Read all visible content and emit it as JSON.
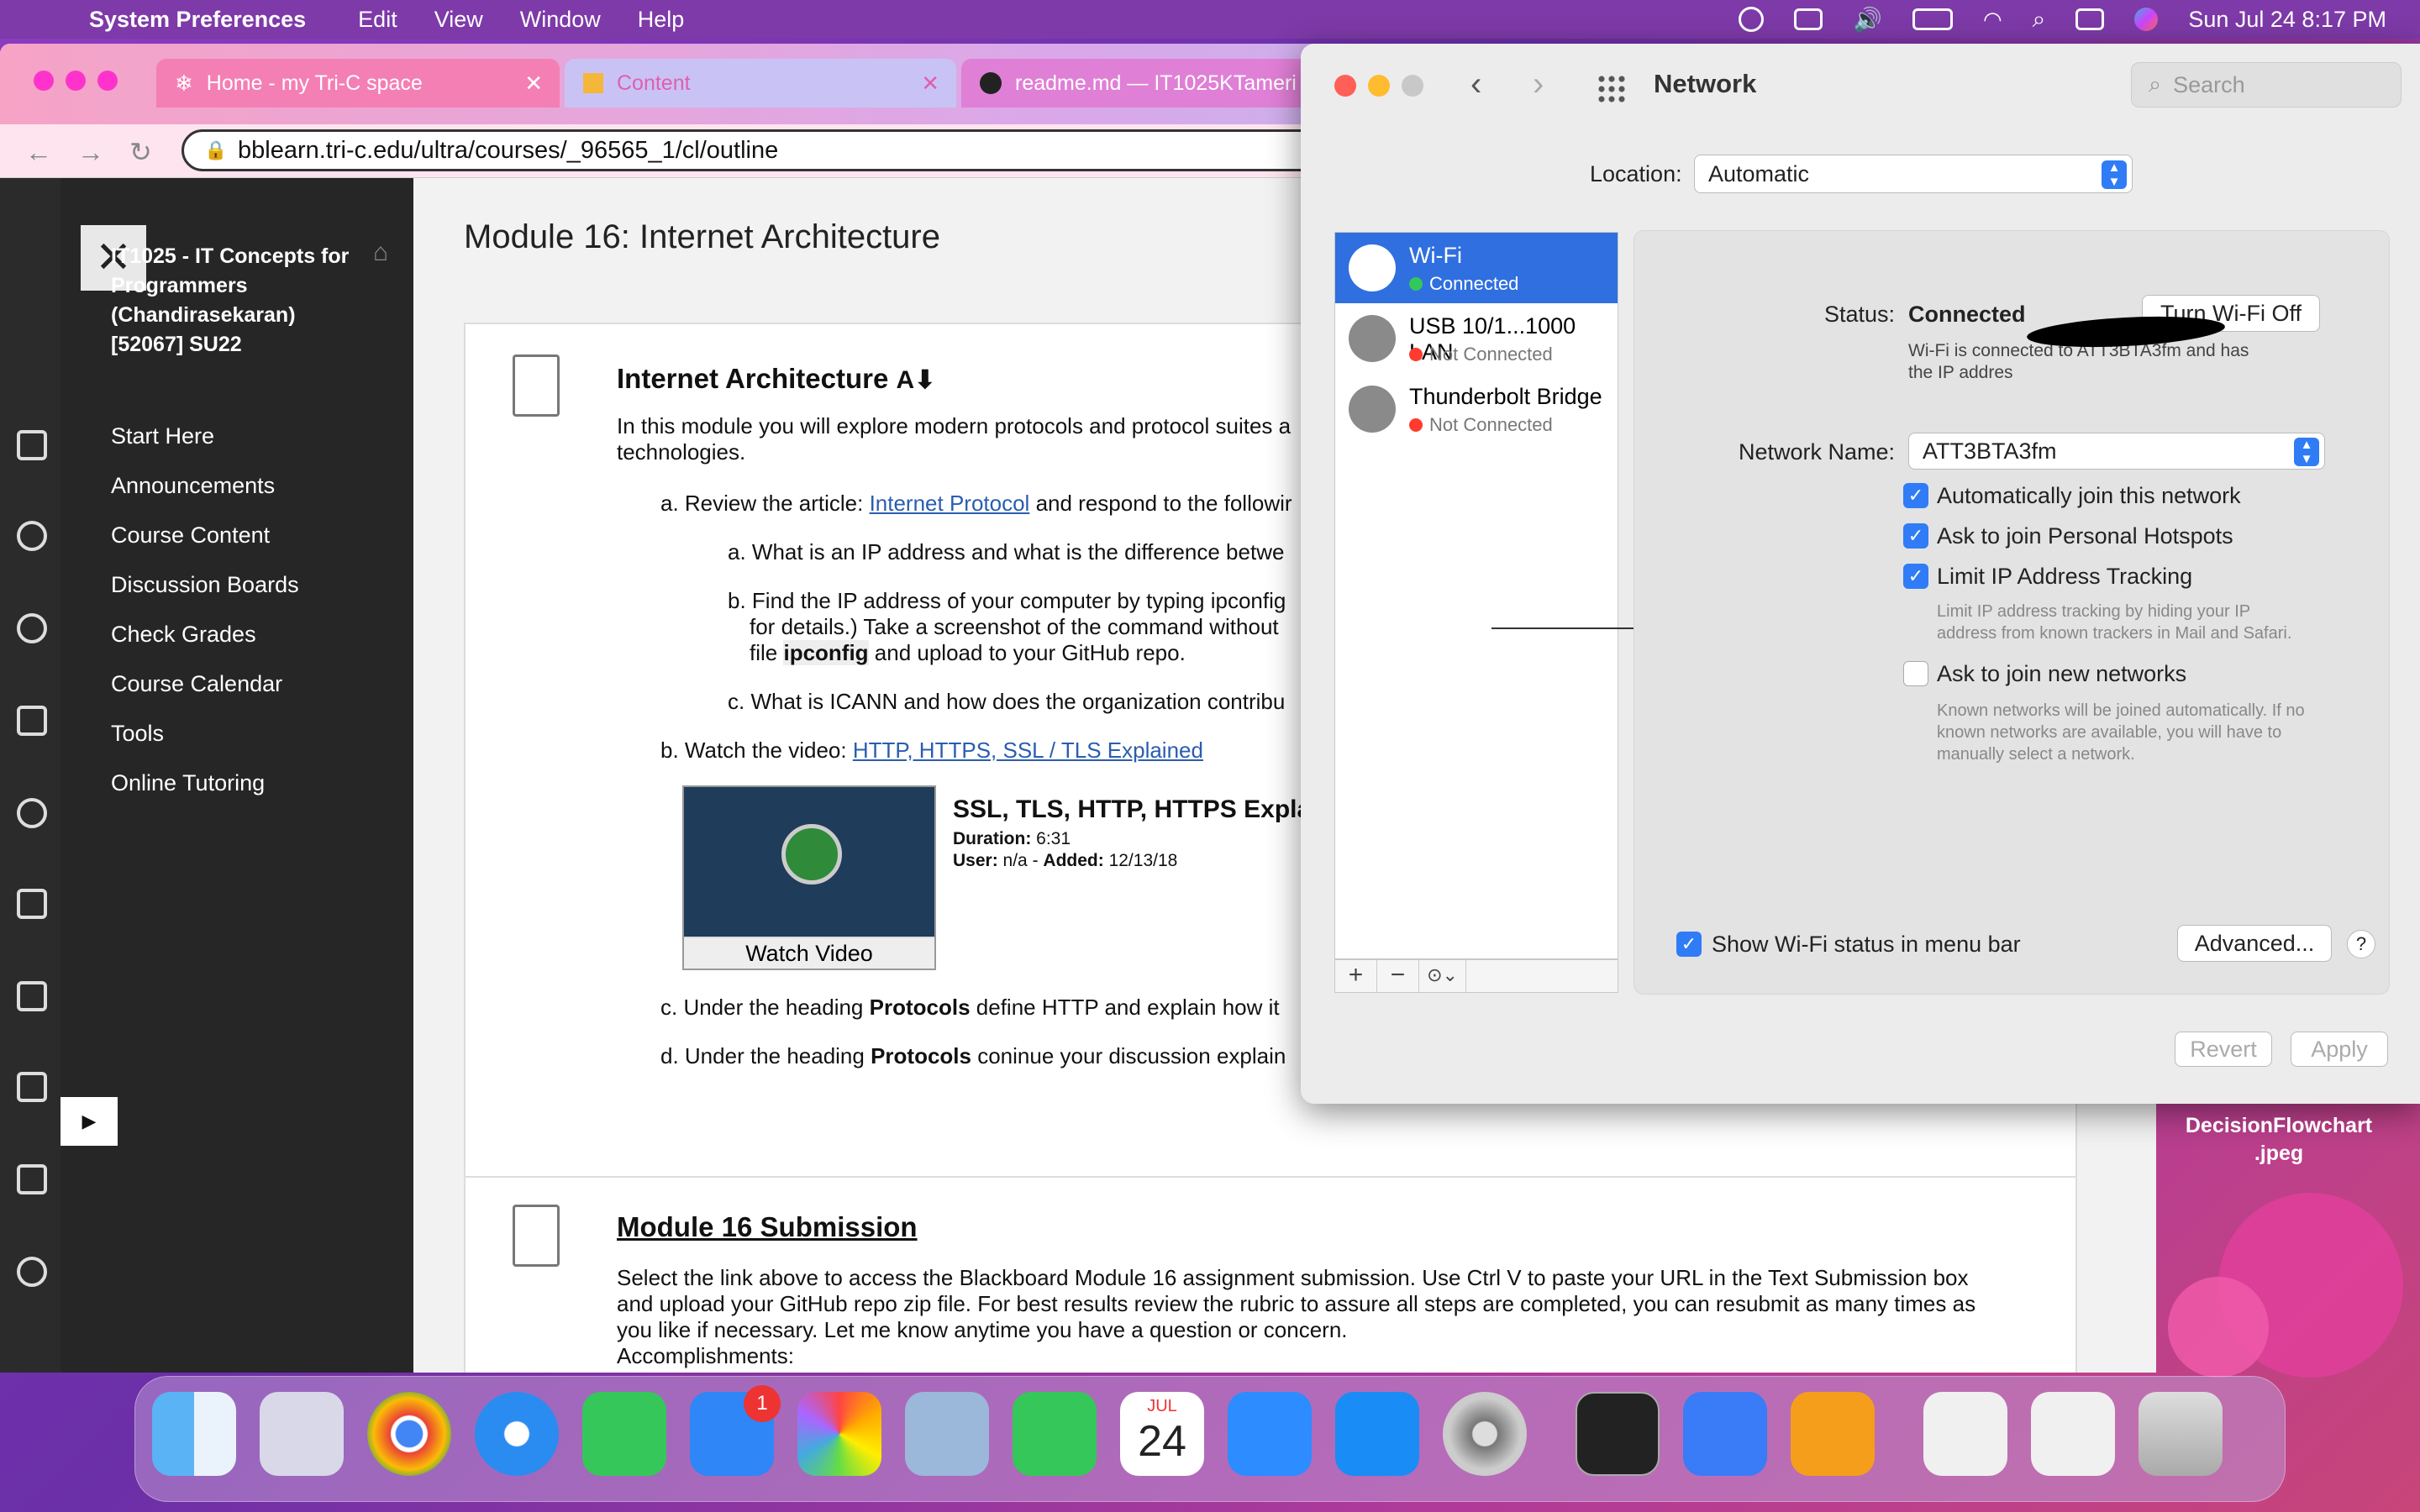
{
  "menubar": {
    "app": "System Preferences",
    "items": [
      "Edit",
      "View",
      "Window",
      "Help"
    ],
    "datetime": "Sun Jul 24  8:17 PM"
  },
  "browser": {
    "tabs": [
      {
        "title": "Home - my Tri-C space"
      },
      {
        "title": "Content"
      },
      {
        "title": "readme.md — IT1025KTameri"
      }
    ],
    "url": "bblearn.tri-c.edu/ultra/courses/_96565_1/cl/outline"
  },
  "course": {
    "title": "IT1025 - IT Concepts for Programmers (Chandirasekaran) [52067] SU22",
    "nav": [
      "Start Here",
      "Announcements",
      "Course Content",
      "Discussion Boards",
      "Check Grades",
      "Course Calendar",
      "Tools",
      "Online Tutoring"
    ]
  },
  "content": {
    "module_title": "Module 16: Internet Architecture",
    "section_title": "Internet Architecture",
    "intro": "In this module you will explore modern protocols and protocol suites a",
    "intro2": "technologies.",
    "a_prefix": "a. Review the article: ",
    "a_link": "Internet Protocol",
    "a_suffix": " and respond to the followir",
    "a_a": "a. What is an IP address and what is the difference betwe",
    "a_b1": "b. Find the IP address of your computer by typing ipconfig",
    "a_b2": "for details.) Take a screenshot of the command without",
    "a_b3_pre": "file ",
    "a_b3_bold": "ipconfig",
    "a_b3_post": " and upload to your GitHub repo.",
    "a_c": "c. What is ICANN and how does the organization contribu",
    "b_prefix": "b. Watch the video: ",
    "b_link": "HTTP, HTTPS, SSL / TLS Explained",
    "video_title": "SSL, TLS, HTTP, HTTPS Expla",
    "video_duration_label": "Duration:",
    "video_duration": "6:31",
    "video_user_label": "User:",
    "video_user": "n/a - ",
    "video_added_label": "Added:",
    "video_added": "12/13/18",
    "video_button": "Watch Video",
    "c_pre": "c. Under the heading ",
    "c_bold": "Protocols",
    "c_post": " define HTTP and explain how it",
    "d_pre": "d. Under the heading ",
    "d_bold": "Protocols",
    "d_post": " coninue your discussion explain",
    "submission_title": "Module 16 Submission",
    "submission_text1": "Select the link above to access the Blackboard Module 16 assignment submission.  Use Ctrl V to paste your URL in the Text Submission box",
    "submission_text2": "and upload your GitHub repo zip file. For best results review the rubric to assure all steps are completed, you can resubmit as many times as",
    "submission_text3": "you like if necessary. Let me know anytime you have a question or concern.",
    "submission_text4": "Accomplishments:"
  },
  "network": {
    "title": "Network",
    "search_placeholder": "Search",
    "location_label": "Location:",
    "location_value": "Automatic",
    "services": [
      {
        "name": "Wi-Fi",
        "status": "Connected",
        "status_color": "#34c759"
      },
      {
        "name": "USB 10/1...1000 LAN",
        "status": "Not Connected",
        "status_color": "#ff3b30"
      },
      {
        "name": "Thunderbolt Bridge",
        "status": "Not Connected",
        "status_color": "#ff3b30"
      }
    ],
    "status_label": "Status:",
    "status_value": "Connected",
    "turn_off_button": "Turn Wi-Fi Off",
    "status_desc1": "Wi-Fi is connected to ATT3BTA3fm and has",
    "status_desc2": "the IP addres",
    "network_name_label": "Network Name:",
    "network_name_value": "ATT3BTA3fm",
    "checkboxes": [
      {
        "label": "Automatically join this network",
        "checked": true
      },
      {
        "label": "Ask to join Personal Hotspots",
        "checked": true
      },
      {
        "label": "Limit IP Address Tracking",
        "checked": true
      },
      {
        "label": "Ask to join new networks",
        "checked": false
      }
    ],
    "limit_note1": "Limit IP address tracking by hiding your IP",
    "limit_note2": "address from known trackers in Mail and Safari.",
    "join_note1": "Known networks will be joined automatically. If no",
    "join_note2": "known networks are available, you will have to",
    "join_note3": "manually select a network.",
    "show_status_label": "Show Wi-Fi status in menu bar",
    "advanced_button": "Advanced...",
    "help_button": "?",
    "revert_button": "Revert",
    "apply_button": "Apply"
  },
  "desktop": {
    "file_label1": "DecisionFlowchart",
    "file_label2": ".jpeg"
  },
  "dock": {
    "calendar_month": "JUL",
    "calendar_day": "24",
    "mail_badge": "1"
  }
}
